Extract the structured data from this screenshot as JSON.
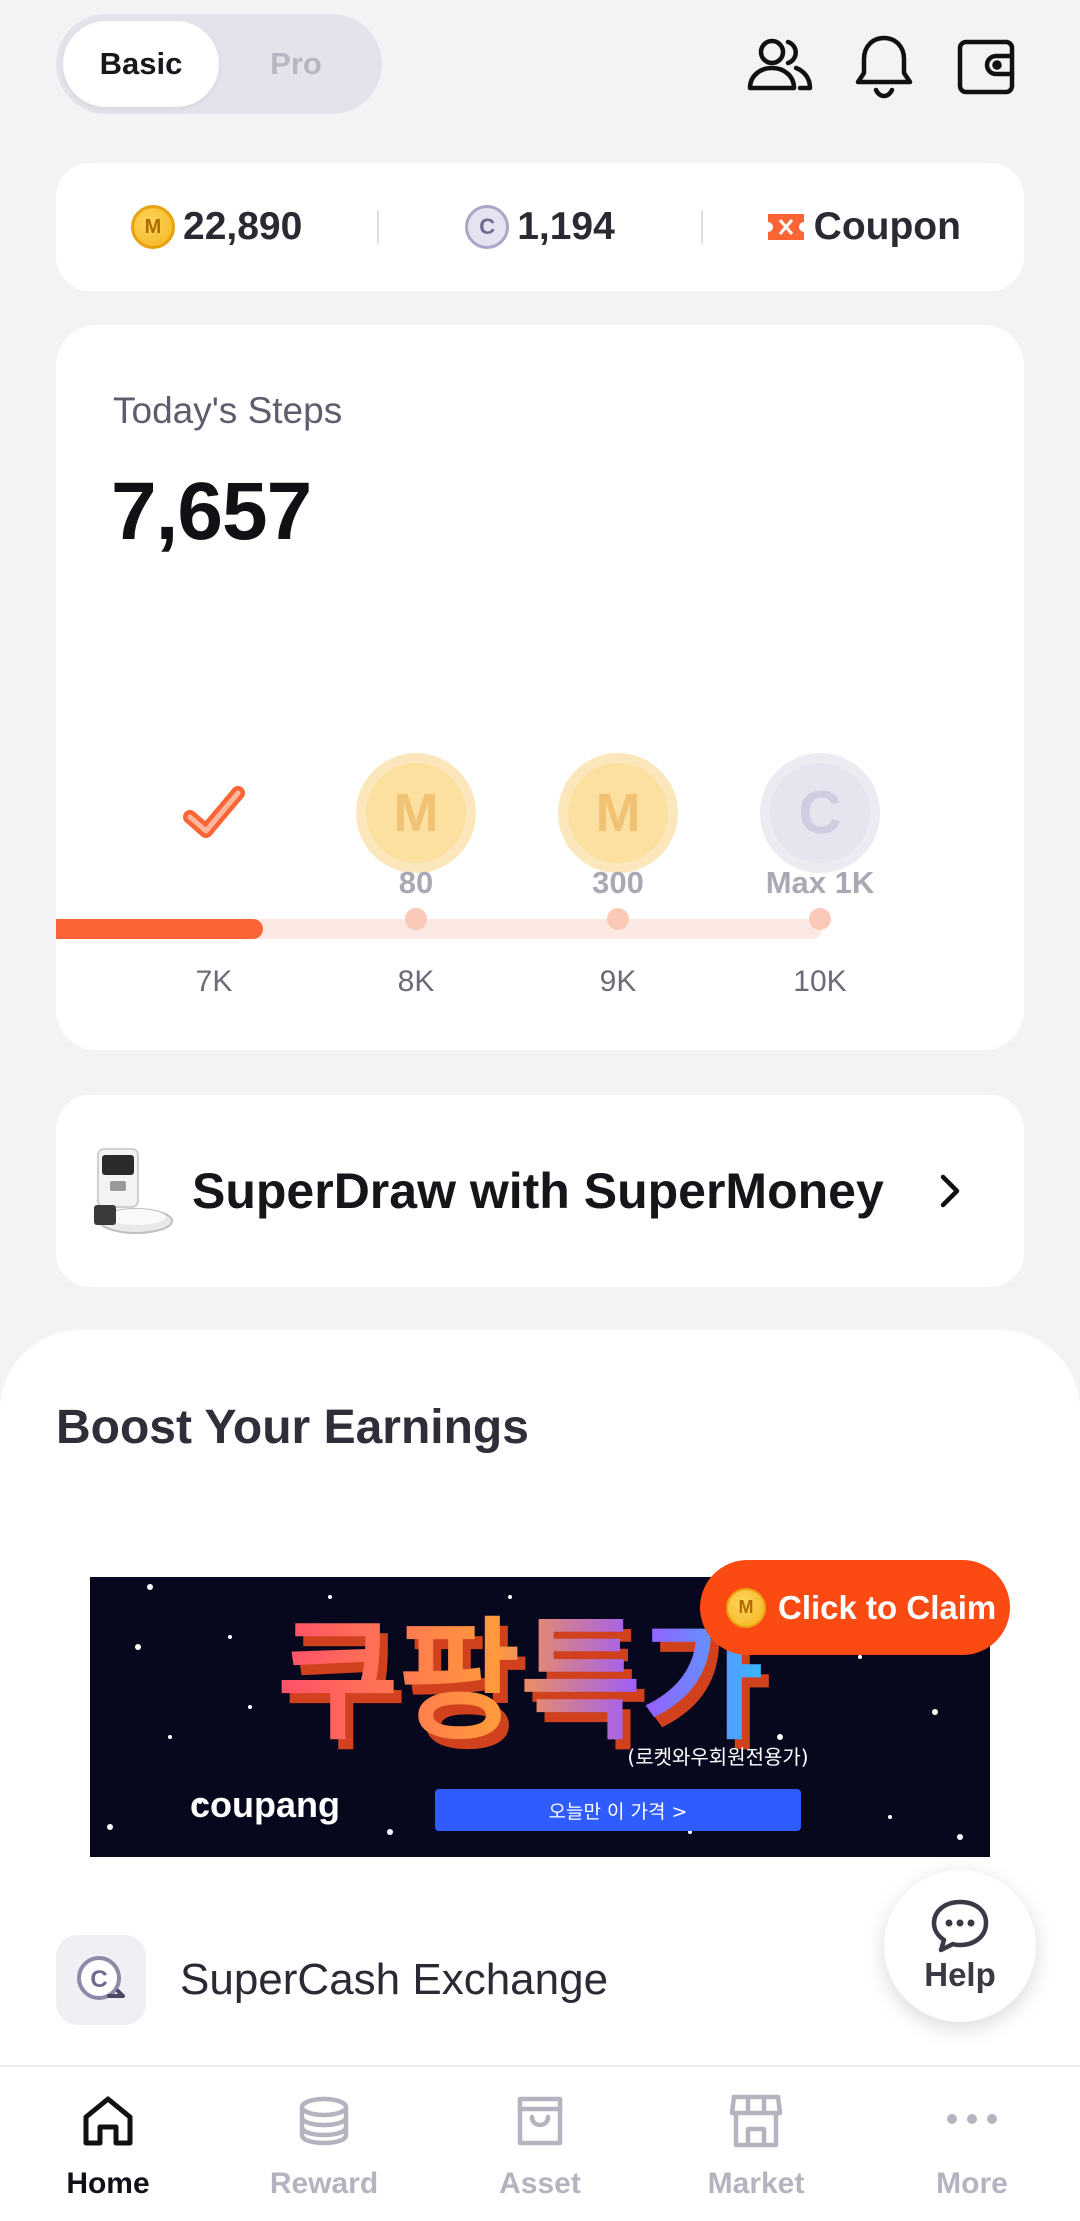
{
  "header": {
    "mode_options": [
      "Basic",
      "Pro"
    ],
    "active_mode": "Basic",
    "icons": [
      "friends-icon",
      "bell-icon",
      "wallet-icon"
    ]
  },
  "balances": {
    "supermoney": "22,890",
    "supercash": "1,194",
    "coupon_label": "Coupon",
    "coin_m_letter": "M",
    "coin_c_letter": "C"
  },
  "steps": {
    "label": "Today's Steps",
    "value": "7,657",
    "progress_fraction": 0.27,
    "milestones": [
      {
        "step_label": "7K",
        "reward": "",
        "coin": "done",
        "icon_letter": ""
      },
      {
        "step_label": "8K",
        "reward": "80",
        "coin": "M",
        "icon_letter": "M"
      },
      {
        "step_label": "9K",
        "reward": "300",
        "coin": "M",
        "icon_letter": "M"
      },
      {
        "step_label": "10K",
        "reward": "Max 1K",
        "coin": "C",
        "icon_letter": "C"
      }
    ]
  },
  "superdraw": {
    "label": "SuperDraw with SuperMoney"
  },
  "boost": {
    "title": "Boost Your Earnings",
    "banner": {
      "headline": "쿠팡특가",
      "sub": "(로켓와우회원전용가)",
      "brand": "coupang",
      "cta": "오늘만 이 가격 >"
    },
    "claim_label": "Click to Claim",
    "exchange_label": "SuperCash Exchange"
  },
  "help": {
    "label": "Help"
  },
  "nav": {
    "items": [
      {
        "label": "Home",
        "icon": "home-icon"
      },
      {
        "label": "Reward",
        "icon": "coins-stack-icon"
      },
      {
        "label": "Asset",
        "icon": "bag-icon"
      },
      {
        "label": "Market",
        "icon": "store-icon"
      },
      {
        "label": "More",
        "icon": "more-dots-icon"
      }
    ],
    "active": "Home"
  },
  "colors": {
    "accent": "#fb6535",
    "claim": "#fb4a12",
    "background": "#f3f3f6"
  }
}
